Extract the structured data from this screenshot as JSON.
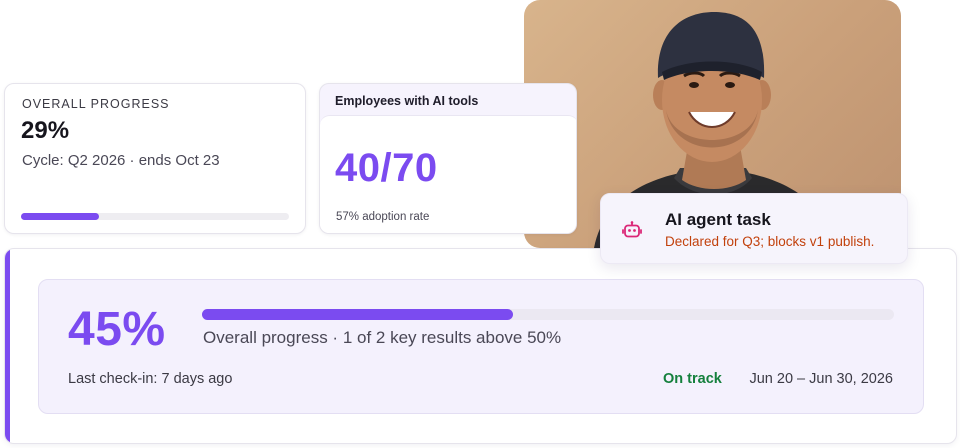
{
  "overall_card": {
    "eyebrow": "OVERALL PROGRESS",
    "percent_label": "29%",
    "cycle": "Cycle: Q2 2026 · ends Oct 23",
    "progress_fraction": 0.29
  },
  "employees_card": {
    "heading": "Employees with AI tools",
    "fraction": "40/70",
    "adoption": "57% adoption rate"
  },
  "agent_card": {
    "icon": "robot-icon",
    "title": "AI agent task",
    "description": "Declared for Q3; blocks v1 publish."
  },
  "progress_panel": {
    "percent_label": "45%",
    "progress_fraction": 0.45,
    "caption": "Overall progress · 1 of 2 key results above 50%",
    "last_checkin": "Last check-in: 7 days ago",
    "status": "On track",
    "date_range": "Jun 20 – Jun 30, 2026"
  },
  "colors": {
    "accent": "#7b4bf0",
    "on_track": "#15803d",
    "warning_text": "#c2410c"
  }
}
